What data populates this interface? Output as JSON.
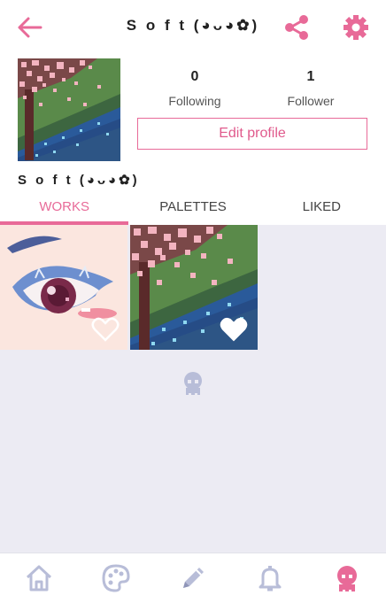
{
  "header": {
    "title": "S o f t (◕ᴗ◕✿)"
  },
  "profile": {
    "username": "S o f t (◕ᴗ◕✿)",
    "following_count": "0",
    "following_label": "Following",
    "follower_count": "1",
    "follower_label": "Follower",
    "edit_label": "Edit profile"
  },
  "tabs": [
    {
      "label": "WORKS",
      "active": true
    },
    {
      "label": "PALETTES",
      "active": false
    },
    {
      "label": "LIKED",
      "active": false
    }
  ],
  "works": [
    {
      "title": "eye artwork",
      "liked": false
    },
    {
      "title": "cherry blossom river",
      "liked": true
    }
  ],
  "nav": [
    {
      "icon": "home-icon",
      "active": false
    },
    {
      "icon": "palette-icon",
      "active": false
    },
    {
      "icon": "pencil-icon",
      "active": false
    },
    {
      "icon": "bell-icon",
      "active": false
    },
    {
      "icon": "profile-icon",
      "active": true
    }
  ],
  "colors": {
    "accent": "#e86a98",
    "inactive_icon": "#b8bdd8",
    "background": "#ecebf3"
  }
}
